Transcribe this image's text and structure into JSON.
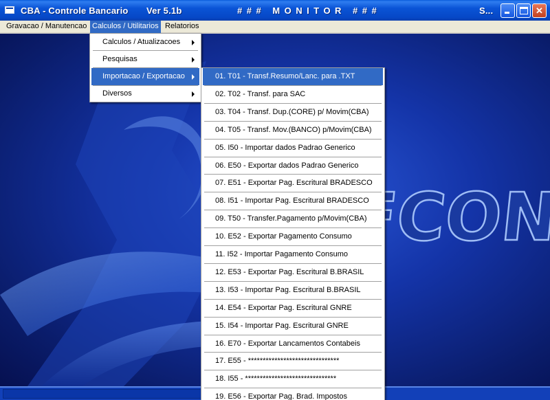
{
  "window": {
    "title": "CBA - Controle Bancario",
    "version": "Ver 5.1b",
    "monitor": "### MONITOR ###",
    "right_text": "S..."
  },
  "menubar": {
    "items": [
      {
        "label": "Gravacao / Manutencao"
      },
      {
        "label": "Calculos / Utilitarios"
      },
      {
        "label": "Relatorios"
      }
    ]
  },
  "calc_menu": {
    "items": [
      {
        "label": "Calculos / Atualizacoes"
      },
      {
        "label": "Pesquisas"
      },
      {
        "label": "Importacao / Exportacao"
      },
      {
        "label": "Diversos"
      }
    ]
  },
  "export_menu": {
    "items": [
      {
        "label": "01. T01 - Transf.Resumo/Lanc. para .TXT"
      },
      {
        "label": "02. T02 - Transf. para SAC"
      },
      {
        "label": "03. T04 - Transf. Dup.(CORE) p/ Movim(CBA)"
      },
      {
        "label": "04. T05 - Transf. Mov.(BANCO) p/Movim(CBA)"
      },
      {
        "label": "05. I50 - Importar dados Padrao Generico"
      },
      {
        "label": "06. E50 - Exportar dados Padrao Generico"
      },
      {
        "label": "07. E51 - Exportar Pag. Escritural BRADESCO"
      },
      {
        "label": "08. I51 - Importar Pag. Escritural BRADESCO"
      },
      {
        "label": "09. T50 - Transfer.Pagamento p/Movim(CBA)"
      },
      {
        "label": "10. E52 - Exportar Pagamento Consumo"
      },
      {
        "label": "11. I52 - Importar Pagamento Consumo"
      },
      {
        "label": "12. E53 - Exportar Pag. Escritural B.BRASIL"
      },
      {
        "label": "13. I53 - Importar Pag. Escritural B.BRASIL"
      },
      {
        "label": "14. E54 - Exportar Pag. Escritural GNRE"
      },
      {
        "label": "15. I54 - Importar Pag. Escritural GNRE"
      },
      {
        "label": "16. E70 - Exportar Lancamentos Contabeis"
      },
      {
        "label": "17. E55 - *******************************"
      },
      {
        "label": "18. I55 - *******************************"
      },
      {
        "label": "19. E56 - Exportar Pag. Brad. Impostos"
      }
    ]
  },
  "background": {
    "logo_text": "FCON"
  }
}
